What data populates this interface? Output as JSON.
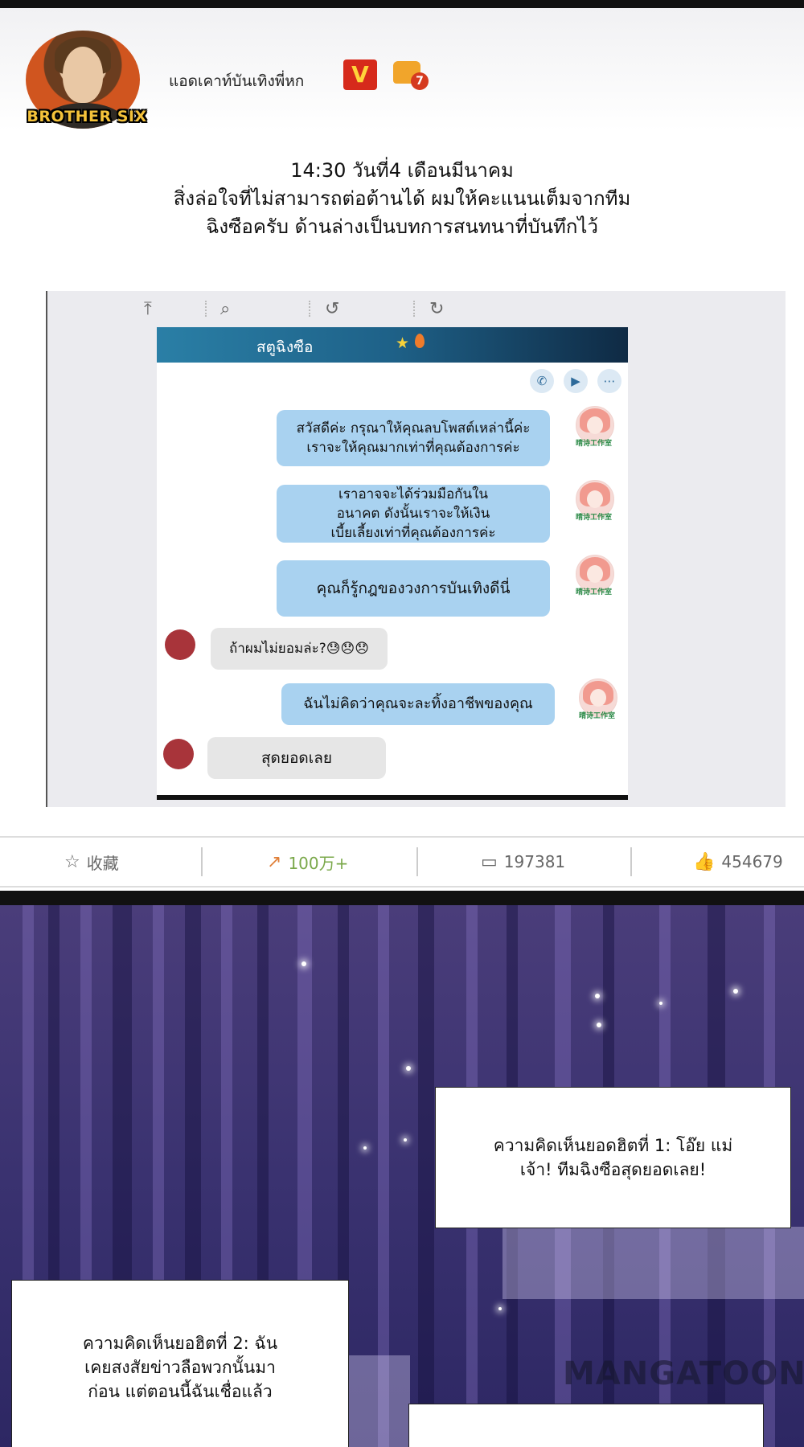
{
  "header": {
    "avatar_label": "BROTHER SIX",
    "username": "แอดเคาท์บันเทิงพี่หก",
    "verified_badge": "V",
    "level_badge": "7"
  },
  "post": {
    "line1": "14:30 วันที่4 เดือนมีนาคม",
    "line2": "สิ่งล่อใจที่ไม่สามารถต่อต้านได้ ผมให้คะแนนเต็มจากทีม",
    "line3": "ฉิงซือครับ ด้านล่างเป็นบทการสนทนาที่บันทึกไว้"
  },
  "chat": {
    "contact_name": "สตูฉิงซือ",
    "avatar_tag": "晴诗工作室",
    "messages": [
      {
        "side": "right",
        "text": "สวัสดีค่ะ กรุณาให้คุณลบโพสต์เหล่านี้ค่ะ\nเราจะให้คุณมากเท่าที่คุณต้องการค่ะ"
      },
      {
        "side": "right",
        "text": "เราอาจจะได้ร่วมมือกันใน\nอนาคต ดังนั้นเราจะให้เงิน\nเบี้ยเลี้ยงเท่าที่คุณต้องการค่ะ"
      },
      {
        "side": "right",
        "text": "คุณก็รู้กฎของวงการบันเทิงดีนี่"
      },
      {
        "side": "left",
        "text": "ถ้าผมไม่ยอมล่ะ?😓😞😞"
      },
      {
        "side": "right",
        "text": "ฉันไม่คิดว่าคุณจะละทิ้งอาชีพของคุณ"
      },
      {
        "side": "left",
        "text": "สุดยอดเลย"
      }
    ]
  },
  "stats": {
    "favorite": "收藏",
    "shares": "100万+",
    "comments": "197381",
    "likes": "454679"
  },
  "panel": {
    "caption1": "ความคิดเห็นยอดฮิตที่ 1: โอ๊ย แม่\nเจ้า! ทีมฉิงซือสุดยอดเลย!",
    "caption2": "ความคิดเห็นยอฮิตที่ 2: ฉัน\nเคยสงสัยข่าวลือพวกนั้นมา\nก่อน แต่ตอนนี้ฉันเชื่อแล้ว",
    "watermark": "MANGATOON"
  },
  "colors": {
    "chat_blue": "#a9d2f0",
    "shares_green": "#7aa84a",
    "shares_icon": "#e0803a",
    "verified_red": "#d62a1b"
  },
  "icons": [
    "star-outline-icon",
    "share-icon",
    "comment-icon",
    "thumbs-up-icon",
    "phone-icon",
    "video-icon",
    "more-icon",
    "upload-icon",
    "search-icon",
    "undo-icon",
    "redo-icon"
  ]
}
